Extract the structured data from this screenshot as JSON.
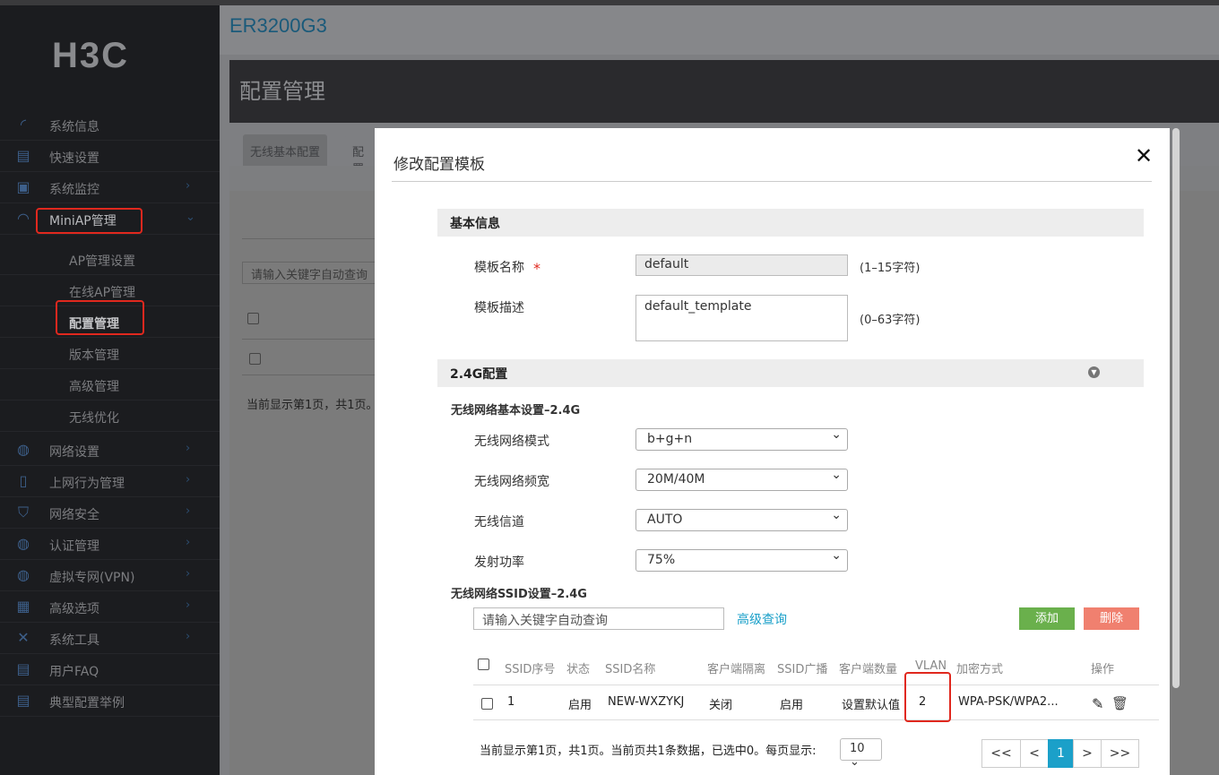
{
  "brand": "H3C",
  "product": "ER3200G3",
  "page_title": "配置管理",
  "sidebar": [
    {
      "label": "系统信息",
      "icon": "gauge-icon"
    },
    {
      "label": "快速设置",
      "icon": "document-wrench-icon"
    },
    {
      "label": "系统监控",
      "icon": "monitor-chart-icon"
    },
    {
      "label": "MiniAP管理",
      "icon": "wifi-icon"
    },
    {
      "label": "网络设置",
      "icon": "globe-icon"
    },
    {
      "label": "上网行为管理",
      "icon": "document-lock-icon"
    },
    {
      "label": "网络安全",
      "icon": "shield-icon"
    },
    {
      "label": "认证管理",
      "icon": "globe-lock-icon"
    },
    {
      "label": "虚拟专网(VPN)",
      "icon": "globe-vpn-icon"
    },
    {
      "label": "高级选项",
      "icon": "grid-icon"
    },
    {
      "label": "系统工具",
      "icon": "tools-icon"
    },
    {
      "label": "用户FAQ",
      "icon": "faq-icon"
    },
    {
      "label": "典型配置举例",
      "icon": "example-icon"
    }
  ],
  "submenu": [
    "AP管理设置",
    "在线AP管理",
    "配置管理",
    "版本管理",
    "高级管理",
    "无线优化"
  ],
  "tabs": [
    "无线基本配置",
    "配置"
  ],
  "bg": {
    "search_placeholder": "请输入关键字自动查询",
    "footer": "当前显示第1页，共1页。"
  },
  "modal": {
    "title": "修改配置模板",
    "basic_section": "基本信息",
    "name_label": "模板名称",
    "name_required": "*",
    "name_value": "default",
    "name_hint": "(1–15字符)",
    "desc_label": "模板描述",
    "desc_value": "default_template",
    "desc_hint": "(0–63字符)",
    "g24_section": "2.4G配置",
    "wireless_basic": "无线网络基本设置–2.4G",
    "mode_label": "无线网络模式",
    "mode_value": "b+g+n",
    "bw_label": "无线网络频宽",
    "bw_value": "20M/40M",
    "channel_label": "无线信道",
    "channel_value": "AUTO",
    "power_label": "发射功率",
    "power_value": "75%",
    "ssid_settings": "无线网络SSID设置–2.4G",
    "search_placeholder": "请输入关键字自动查询",
    "advanced_query": "高级查询",
    "add": "添加",
    "delete": "删除",
    "columns": [
      "SSID序号",
      "状态",
      "SSID名称",
      "客户端隔离",
      "SSID广播",
      "客户端数量",
      "VLAN",
      "加密方式",
      "操作"
    ],
    "rows": [
      [
        "1",
        "启用",
        "NEW-WXZYKJ",
        "关闭",
        "启用",
        "设置默认值",
        "2",
        "WPA-PSK/WPA2..."
      ]
    ],
    "footer": "当前显示第1页，共1页。当前页共1条数据，已选中0。每页显示:",
    "page_size": "10",
    "pager": [
      "<<",
      "<",
      "1",
      ">",
      ">>"
    ]
  },
  "colors": {
    "accent": "#1ba0c9",
    "add": "#6ab04c",
    "delete": "#f0806f",
    "highlight": "#e0281e"
  }
}
